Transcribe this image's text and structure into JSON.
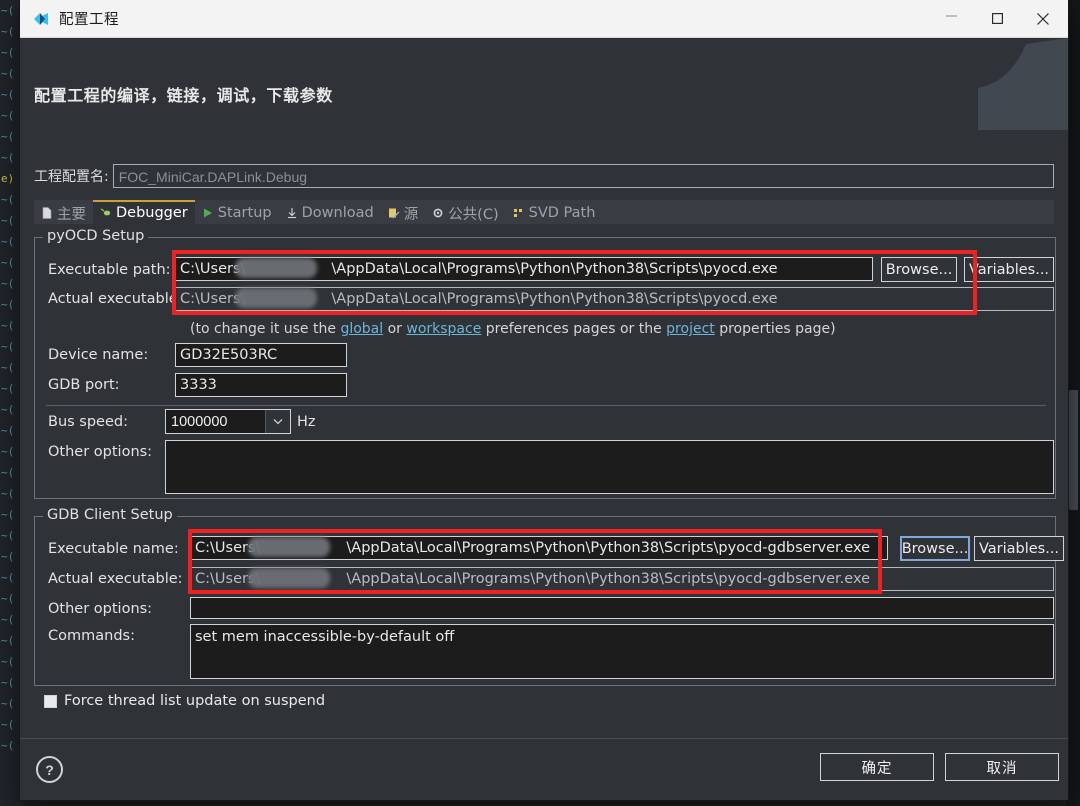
{
  "window": {
    "title": "配置工程",
    "icon": "app-icon",
    "minimize": "—",
    "maximize": "▢",
    "close": "✕"
  },
  "headline": "配置工程的编译，链接，调试，下载参数",
  "config_name": {
    "label": "工程配置名:",
    "value": "FOC_MiniCar.DAPLink.Debug"
  },
  "tabs": [
    {
      "label": "主要",
      "icon": "document-icon",
      "active": false
    },
    {
      "label": "Debugger",
      "icon": "bug-icon",
      "active": true
    },
    {
      "label": "Startup",
      "icon": "play-icon",
      "active": false
    },
    {
      "label": "Download",
      "icon": "download-icon",
      "active": false
    },
    {
      "label": "源",
      "icon": "source-icon",
      "active": false
    },
    {
      "label": "公共(C)",
      "icon": "gear-icon",
      "active": false
    },
    {
      "label": "SVD Path",
      "icon": "svd-icon",
      "active": false
    }
  ],
  "pyocd": {
    "group_title": "pyOCD Setup",
    "executable_path": {
      "label": "Executable path:",
      "value_prefix": "C:\\Users\\",
      "value_suffix": "\\AppData\\Local\\Programs\\Python\\Python38\\Scripts\\pyocd.exe",
      "redacted": true
    },
    "actual_executable": {
      "label": "Actual executable:",
      "value_prefix": "C:\\Users\\",
      "value_suffix": "\\AppData\\Local\\Programs\\Python\\Python38\\Scripts\\pyocd.exe",
      "redacted": true
    },
    "browse_label": "Browse...",
    "variables_label": "Variables...",
    "hint": {
      "pre": "(to change it use the ",
      "link1": "global",
      "mid1": " or ",
      "link2": "workspace",
      "mid2": " preferences pages or the ",
      "link3": "project",
      "post": " properties page)"
    },
    "device_name": {
      "label": "Device name:",
      "value": "GD32E503RC"
    },
    "gdb_port": {
      "label": "GDB port:",
      "value": "3333"
    },
    "bus_speed": {
      "label": "Bus speed:",
      "value": "1000000",
      "unit": "Hz",
      "arrow": "⌄"
    },
    "other_options": {
      "label": "Other options:",
      "value": ""
    }
  },
  "gdb_client": {
    "group_title": "GDB Client Setup",
    "executable_name": {
      "label": "Executable name:",
      "value_prefix": "C:\\Users\\",
      "value_suffix": "\\AppData\\Local\\Programs\\Python\\Python38\\Scripts\\pyocd-gdbserver.exe",
      "redacted": true
    },
    "actual_executable": {
      "label": "Actual executable:",
      "value_prefix": "C:\\Users\\",
      "value_suffix": "\\AppData\\Local\\Programs\\Python\\Python38\\Scripts\\pyocd-gdbserver.exe",
      "redacted": true
    },
    "browse_label": "Browse...",
    "variables_label": "Variables...",
    "other_options": {
      "label": "Other options:",
      "value": ""
    },
    "commands": {
      "label": "Commands:",
      "value": "set mem inaccessible-by-default off"
    }
  },
  "force_thread": {
    "label": "Force thread list update on suspend",
    "checked": false
  },
  "footer": {
    "help": "?",
    "ok": "确定",
    "cancel": "取消"
  },
  "colors": {
    "dialog_bg": "#2f3237",
    "field_bg": "#1c1c1c",
    "titlebar_bg": "#f3f3f3",
    "annotation": "#ee2222",
    "active_tab_underline": "#c8a13a",
    "link": "#6cb6d9"
  },
  "annotations": [
    {
      "name": "pyocd-paths-highlight"
    },
    {
      "name": "gdb-paths-highlight"
    }
  ],
  "backdrop": {
    "code_marks": [
      "~(",
      "~(",
      "~(",
      "~(",
      "~(",
      "~(",
      "~(",
      "~(",
      "e)",
      "~(",
      "~(",
      "~(",
      "~(",
      "~(",
      "~(",
      "~(",
      "~(",
      "~(",
      "~(",
      "~(",
      "~(",
      "~(",
      "~(",
      "~(",
      "~(",
      "~(",
      "~(",
      "~(",
      "~(",
      "~(",
      "~(",
      "~(",
      "~(",
      "~(",
      "~(",
      "~("
    ]
  }
}
